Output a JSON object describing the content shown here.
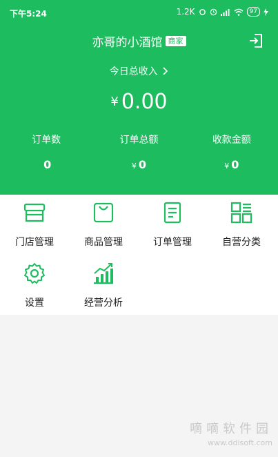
{
  "status_bar": {
    "time": "下午5:24",
    "network_speed": "1.2K",
    "battery": "97"
  },
  "header": {
    "shop_name": "亦哥的小酒馆",
    "shop_badge": "商家",
    "income_label": "今日总收入",
    "income_currency": "¥",
    "income_value": "0.00",
    "stats": [
      {
        "label": "订单数",
        "value": "0",
        "currency": ""
      },
      {
        "label": "订单总额",
        "value": "0",
        "currency": "¥"
      },
      {
        "label": "收款金额",
        "value": "0",
        "currency": "¥"
      }
    ]
  },
  "menu": {
    "items": [
      {
        "label": "门店管理",
        "icon": "store-icon"
      },
      {
        "label": "商品管理",
        "icon": "shopping-bag-icon"
      },
      {
        "label": "订单管理",
        "icon": "order-document-icon"
      },
      {
        "label": "自营分类",
        "icon": "category-grid-icon"
      },
      {
        "label": "设置",
        "icon": "gear-icon"
      },
      {
        "label": "经营分析",
        "icon": "bar-chart-icon"
      }
    ]
  },
  "watermark": {
    "line1": "嘀嘀软件园",
    "line2": "www.ddisoft.com"
  },
  "colors": {
    "brand": "#1dbd5f",
    "icon_green": "#1dbd5f"
  }
}
